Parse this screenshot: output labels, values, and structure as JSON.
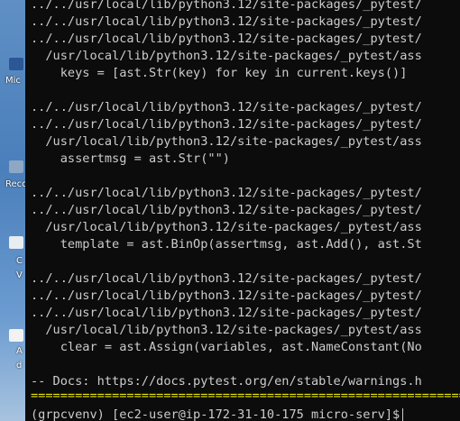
{
  "desktop": {
    "labels": [
      "Mic",
      "Reco",
      "C",
      "V",
      "A",
      "d"
    ]
  },
  "terminal": {
    "lines": [
      "../../usr/local/lib/python3.12/site-packages/_pytest/",
      "../../usr/local/lib/python3.12/site-packages/_pytest/",
      "../../usr/local/lib/python3.12/site-packages/_pytest/",
      "  /usr/local/lib/python3.12/site-packages/_pytest/ass",
      "    keys = [ast.Str(key) for key in current.keys()]",
      "",
      "../../usr/local/lib/python3.12/site-packages/_pytest/",
      "../../usr/local/lib/python3.12/site-packages/_pytest/",
      "  /usr/local/lib/python3.12/site-packages/_pytest/ass",
      "    assertmsg = ast.Str(\"\")",
      "",
      "../../usr/local/lib/python3.12/site-packages/_pytest/",
      "../../usr/local/lib/python3.12/site-packages/_pytest/",
      "  /usr/local/lib/python3.12/site-packages/_pytest/ass",
      "    template = ast.BinOp(assertmsg, ast.Add(), ast.St",
      "",
      "../../usr/local/lib/python3.12/site-packages/_pytest/",
      "../../usr/local/lib/python3.12/site-packages/_pytest/",
      "../../usr/local/lib/python3.12/site-packages/_pytest/",
      "  /usr/local/lib/python3.12/site-packages/_pytest/ass",
      "    clear = ast.Assign(variables, ast.NameConstant(No",
      "",
      "-- Docs: https://docs.pytest.org/en/stable/warnings.h",
      "=================================================================",
      "(grpcvenv) [ec2-user@ip-172-31-10-175 micro-serv]$"
    ]
  },
  "colors": {
    "terminal_bg": "#0c0c0c",
    "terminal_fg": "#cccccc",
    "separator": "#e5e510",
    "desktop": "#4a7fbb"
  }
}
